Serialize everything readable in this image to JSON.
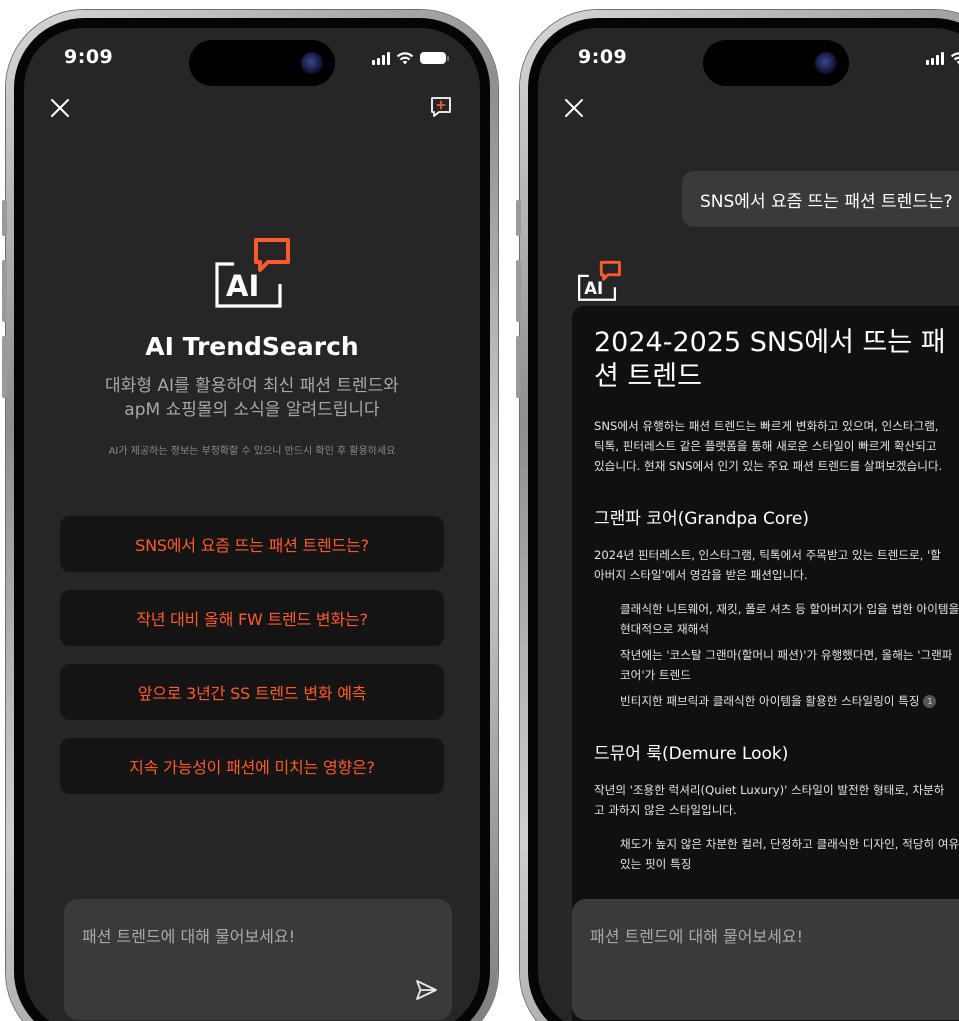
{
  "status": {
    "time": "9:09"
  },
  "welcome": {
    "logo_text": "AI",
    "title": "AI TrendSearch",
    "subtitle_line1": "대화형 AI를 활용하여 최신 패션 트렌드와",
    "subtitle_line2": "apM 쇼핑몰의 소식을 알려드립니다",
    "disclaimer": "AI가 제공하는 정보는 부정확할 수 있으니 반드시 확인 후 활용하세요",
    "suggestions": [
      "SNS에서 요즘 뜨는 패션 트렌드는?",
      "작년 대비 올해 FW 트렌드 변화는?",
      "앞으로 3년간 SS 트렌드 변화 예측",
      "지속 가능성이 패션에 미치는 영향은?"
    ]
  },
  "input": {
    "placeholder": "패션 트렌드에 대해 물어보세요!"
  },
  "chat": {
    "user_message": "SNS에서 요즘 뜨는 패션 트렌드는?",
    "answer": {
      "heading": "2024-2025 SNS에서 뜨는 패션 트렌드",
      "intro": "SNS에서 유행하는 패션 트렌드는 빠르게 변화하고 있으며, 인스타그램, 틱톡, 핀터레스트 같은 플랫폼을 통해 새로운 스타일이 빠르게 확산되고 있습니다. 현재 SNS에서 인기 있는 주요 패션 트렌드를 살펴보겠습니다.",
      "section1_title": "그랜파 코어(Grandpa Core)",
      "section1_text": "2024년 핀터레스트, 인스타그램, 틱톡에서 주목받고 있는 트렌드로, '할아버지 스타일'에서 영감을 받은 패션입니다.",
      "section1_items": [
        "클래식한 니트웨어, 재킷, 폴로 셔츠 등 할아버지가 입을 법한 아이템을 현대적으로 재해석",
        "작년에는 '코스탈 그랜마(할머니 패션)'가 유행했다면, 올해는 '그랜파 코어'가 트렌드",
        "빈티지한 패브릭과 클래식한 아이템을 활용한 스타일링이 특징"
      ],
      "citation": "1",
      "section2_title": "드뮤어 룩(Demure Look)",
      "section2_text": "작년의 '조용한 럭셔리(Quiet Luxury)' 스타일이 발전한 형태로, 차분하고 과하지 않은 스타일입니다.",
      "section2_items": [
        "채도가 높지 않은 차분한 컬러, 단정하고 클래식한 디자인, 적당히 여유 있는 핏이 특징"
      ]
    }
  },
  "colors": {
    "accent": "#ff5a2c",
    "screen_bg": "#262626",
    "card_bg": "#101010"
  },
  "icons": {
    "close": "close-icon",
    "new_chat": "new-chat-icon",
    "send": "send-icon"
  }
}
